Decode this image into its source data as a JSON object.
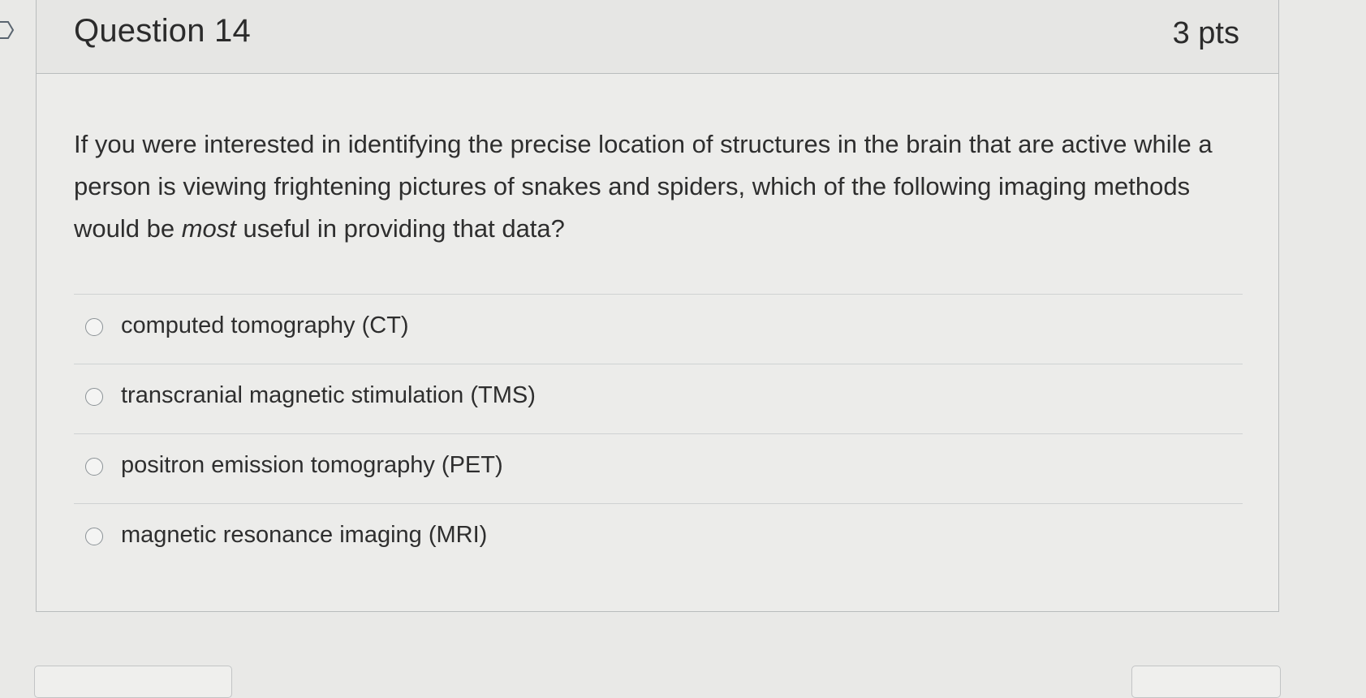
{
  "question": {
    "title": "Question 14",
    "points": "3 pts",
    "text_before_em": "If you were interested in identifying the precise location of structures in the brain that are active while a person is viewing frightening pictures of snakes and spiders, which of the following imaging methods would be ",
    "text_em": "most",
    "text_after_em": " useful in providing that data?"
  },
  "answers": [
    {
      "label": "computed tomography (CT)"
    },
    {
      "label": "transcranial magnetic stimulation (TMS)"
    },
    {
      "label": "positron emission tomography (PET)"
    },
    {
      "label": "magnetic resonance imaging (MRI)"
    }
  ],
  "icons": {
    "flag": "chevron-right-icon",
    "radio": "radio-button-icon"
  },
  "colors": {
    "background": "#e9e9e7",
    "text": "#2e2e2e",
    "border": "#b9bcbd"
  }
}
